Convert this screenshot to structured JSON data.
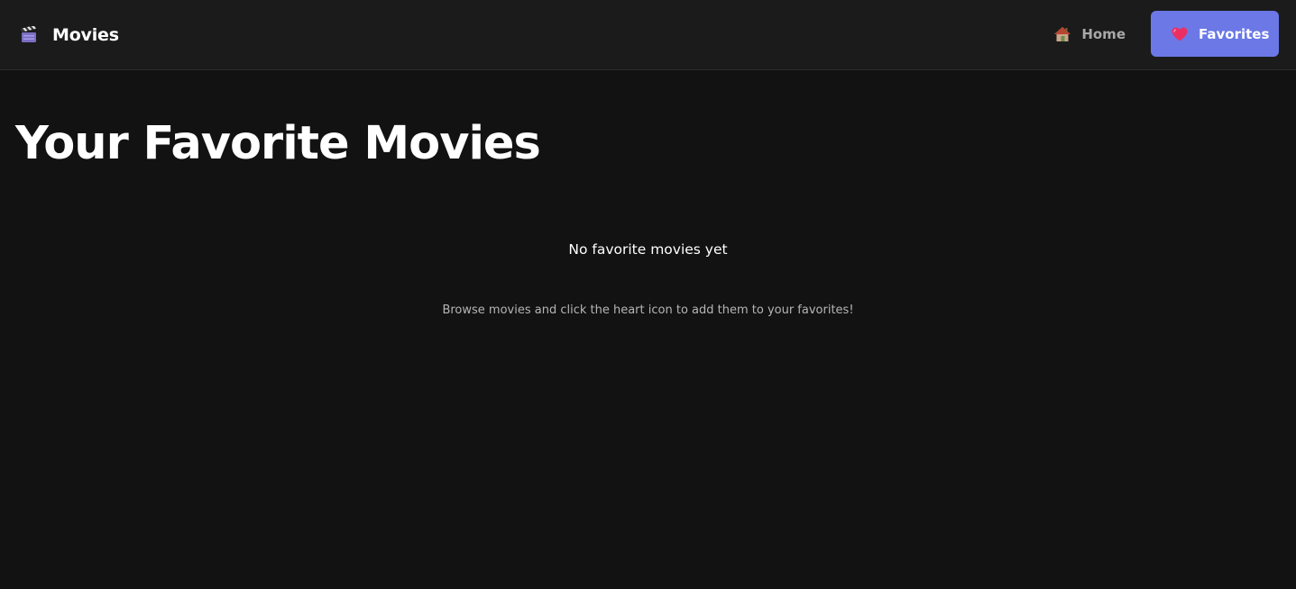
{
  "navbar": {
    "brand": {
      "icon": "clapperboard-icon",
      "label": "Movies"
    },
    "links": [
      {
        "icon": "house-icon",
        "label": "Home",
        "active": false
      },
      {
        "icon": "heart-icon",
        "label": "Favorites",
        "active": true
      }
    ]
  },
  "main": {
    "title": "Your Favorite Movies",
    "empty_state": {
      "title": "No favorite movies yet",
      "hint": "Browse movies and click the heart icon to add them to your favorites!"
    }
  },
  "colors": {
    "background": "#121212",
    "navbar": "#1b1b1b",
    "accent": "#6b78e6",
    "muted_text": "#a8a8a8"
  }
}
